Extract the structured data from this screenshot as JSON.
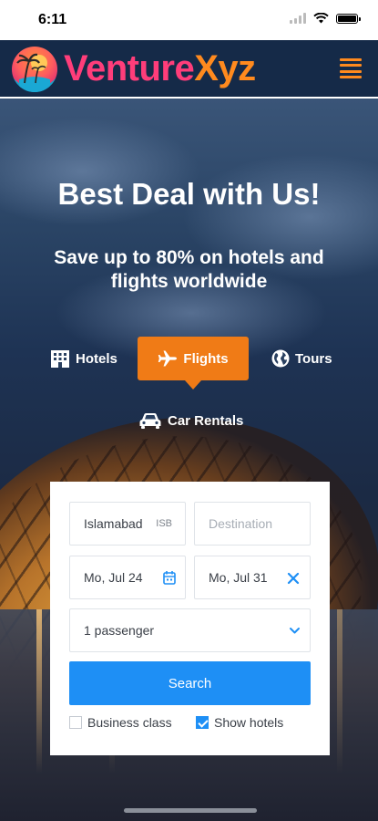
{
  "status_bar": {
    "time": "6:11"
  },
  "brand": {
    "part1": "Venture",
    "part2": "Xyz",
    "color1": "#ff3d7a",
    "color2": "#ff8a1e"
  },
  "hero": {
    "title": "Best Deal with Us!",
    "subtitle": "Save up to 80% on hotels and flights worldwide"
  },
  "tabs": [
    {
      "label": "Hotels",
      "icon": "hotel-icon",
      "active": false
    },
    {
      "label": "Flights",
      "icon": "plane-icon",
      "active": true
    },
    {
      "label": "Tours",
      "icon": "globe-icon",
      "active": false
    },
    {
      "label": "Car Rentals",
      "icon": "car-icon",
      "active": false
    }
  ],
  "form": {
    "origin": {
      "value": "Islamabad",
      "code": "ISB"
    },
    "destination": {
      "placeholder": "Destination"
    },
    "depart_date": "Mo, Jul 24",
    "return_date": "Mo, Jul 31",
    "passengers": "1 passenger",
    "search_label": "Search",
    "business_class": {
      "label": "Business class",
      "checked": false
    },
    "show_hotels": {
      "label": "Show hotels",
      "checked": true
    }
  },
  "colors": {
    "accent": "#f07b16",
    "primary": "#1e8ff5",
    "nav_bg": "#152a48"
  }
}
